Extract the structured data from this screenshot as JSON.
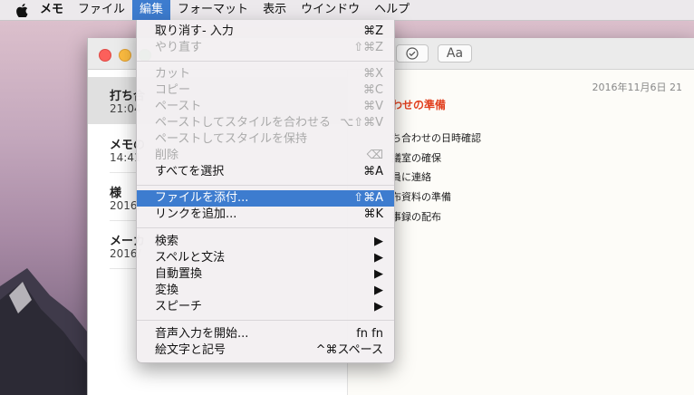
{
  "menubar": {
    "apple_icon": "apple-icon",
    "items": [
      "メモ",
      "ファイル",
      "編集",
      "フォーマット",
      "表示",
      "ウインドウ",
      "ヘルプ"
    ],
    "active_index": 2
  },
  "window": {
    "toolbar": {
      "checklist_icon": "checklist-icon",
      "format_label": "Aa"
    },
    "notes": [
      {
        "title": "打ち合",
        "time": "21:04"
      },
      {
        "title": "メモの",
        "time": "14:41"
      },
      {
        "title": "様",
        "time": "2016/"
      },
      {
        "title": "メーカ",
        "time": "2016/"
      }
    ],
    "content": {
      "date": "2016年11月6日 21",
      "title": "わせの準備",
      "lines": [
        "ち合わせの日時確認",
        "議室の確保",
        "員に連絡",
        "布資料の準備",
        "事録の配布"
      ]
    }
  },
  "edit_menu": {
    "items": [
      {
        "label": "取り消す- 入力",
        "shortcut": "⌘Z",
        "disabled": false
      },
      {
        "label": "やり直す",
        "shortcut": "⇧⌘Z",
        "disabled": true
      },
      {
        "label": "カット",
        "shortcut": "⌘X",
        "disabled": true
      },
      {
        "label": "コピー",
        "shortcut": "⌘C",
        "disabled": true
      },
      {
        "label": "ペースト",
        "shortcut": "⌘V",
        "disabled": true
      },
      {
        "label": "ペーストしてスタイルを合わせる",
        "shortcut": "⌥⇧⌘V",
        "disabled": true
      },
      {
        "label": "ペーストしてスタイルを保持",
        "shortcut": "",
        "disabled": true
      },
      {
        "label": "削除",
        "shortcut": "⌫",
        "disabled": true
      },
      {
        "label": "すべてを選択",
        "shortcut": "⌘A",
        "disabled": false
      },
      {
        "label": "ファイルを添付...",
        "shortcut": "⇧⌘A",
        "disabled": false,
        "highlighted": true
      },
      {
        "label": "リンクを追加...",
        "shortcut": "⌘K",
        "disabled": false
      },
      {
        "label": "検索",
        "shortcut": "▶",
        "disabled": false
      },
      {
        "label": "スペルと文法",
        "shortcut": "▶",
        "disabled": false
      },
      {
        "label": "自動置換",
        "shortcut": "▶",
        "disabled": false
      },
      {
        "label": "変換",
        "shortcut": "▶",
        "disabled": false
      },
      {
        "label": "スピーチ",
        "shortcut": "▶",
        "disabled": false
      },
      {
        "label": "音声入力を開始...",
        "shortcut": "fn fn",
        "disabled": false
      },
      {
        "label": "絵文字と記号",
        "shortcut": "^⌘スペース",
        "disabled": false
      }
    ]
  }
}
